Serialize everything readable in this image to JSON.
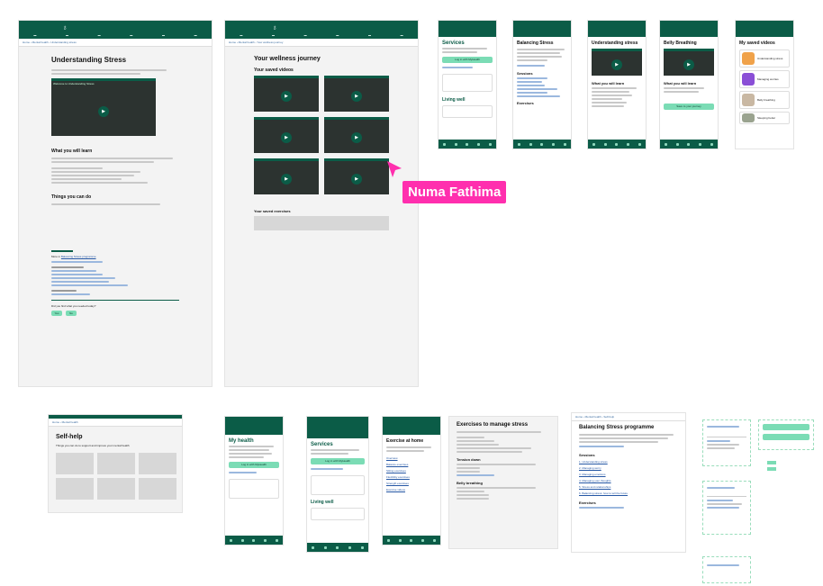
{
  "frames": {
    "understanding_stress": {
      "title": "Understanding Stress",
      "video_caption": "Welcome to Understanding Stress",
      "learn_heading": "What you will learn",
      "can_do_heading": "Things you can do",
      "more_in": "More in",
      "more_in_link": "Balancing Stress programme",
      "feedback_question": "Did you find what you needed today?",
      "yes": "Yes",
      "no": "No"
    },
    "wellness_journey": {
      "title": "Your wellness journey",
      "saved_videos": "Your saved videos",
      "saved_exercises": "Your saved exercises"
    },
    "mobile_services": {
      "title": "Services",
      "login_button": "Log in with MyHealth",
      "living_well": "Living well"
    },
    "mobile_balancing": {
      "title": "Balancing Stress",
      "sessions": "Sessions",
      "exercises": "Exercises"
    },
    "mobile_understanding": {
      "title": "Understanding stress",
      "learn": "What you will learn"
    },
    "mobile_belly": {
      "title": "Belly Breathing",
      "learn": "What you will learn",
      "button": "Save to your journey"
    },
    "mobile_saved": {
      "title": "My saved videos",
      "items": [
        "Understanding stress",
        "Managing worries",
        "Belly breathing",
        "Sleeping better"
      ]
    },
    "self_help": {
      "title": "Self-help",
      "subtitle": "Things you can do to support and improve your mental health"
    },
    "mobile_myhealth": {
      "title": "My health",
      "login_button": "Log in with MyHealth"
    },
    "mobile_services2": {
      "title": "Services",
      "login_button": "Log in with MyHealth",
      "living_well": "Living well"
    },
    "mobile_exercise": {
      "title": "Exercise at home",
      "links": [
        "Overview",
        "Balance exercises",
        "Sitting exercises",
        "Flexibility exercises",
        "Strength exercises",
        "Exercise videos"
      ]
    },
    "exercises_stress": {
      "title": "Exercises to manage stress",
      "tension": "Tension down",
      "belly": "Belly breathing"
    },
    "balancing_programme": {
      "title": "Balancing Stress programme",
      "sessions": "Sessions",
      "session_links": [
        "1. Understanding stress",
        "2. Managing worry",
        "3. Managing emotions",
        "4. Managing your thoughts",
        "5. Stress and relationships",
        "6. Balancing stress: how to tell the future"
      ],
      "exercises": "Exercises"
    },
    "annotation": {
      "name": "Numa Fathima",
      "color": "#ff2fae"
    },
    "colors": {
      "brand": "#0b5c47",
      "accent": "#7bdcb5",
      "link": "#2456a4"
    }
  }
}
